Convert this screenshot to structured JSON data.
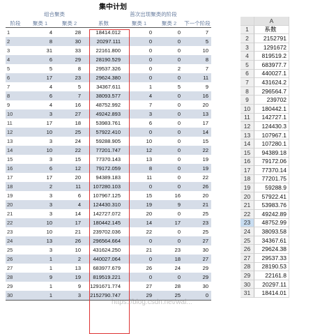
{
  "title": "集中计划",
  "left_table": {
    "group_headers": [
      "组合聚类",
      "首次出现聚类的阶段"
    ],
    "columns": [
      "阶段",
      "聚类 1",
      "聚类 2",
      "系数",
      "聚类 1",
      "聚类 2",
      "下一个阶段"
    ],
    "rows": [
      [
        "1",
        "4",
        "28",
        "18414.012",
        "0",
        "0",
        "7"
      ],
      [
        "2",
        "8",
        "30",
        "20297.111",
        "0",
        "0",
        "5"
      ],
      [
        "3",
        "31",
        "33",
        "22161.800",
        "0",
        "0",
        "10"
      ],
      [
        "4",
        "6",
        "29",
        "28190.529",
        "0",
        "0",
        "8"
      ],
      [
        "5",
        "5",
        "8",
        "29537.326",
        "0",
        "2",
        "7"
      ],
      [
        "6",
        "17",
        "23",
        "29624.380",
        "0",
        "0",
        "11"
      ],
      [
        "7",
        "4",
        "5",
        "34367.611",
        "1",
        "5",
        "9"
      ],
      [
        "8",
        "6",
        "7",
        "38093.577",
        "4",
        "0",
        "16"
      ],
      [
        "9",
        "4",
        "16",
        "48752.992",
        "7",
        "0",
        "20"
      ],
      [
        "10",
        "3",
        "27",
        "49242.893",
        "3",
        "0",
        "13"
      ],
      [
        "11",
        "17",
        "18",
        "53983.761",
        "6",
        "0",
        "17"
      ],
      [
        "12",
        "10",
        "25",
        "57922.410",
        "0",
        "0",
        "14"
      ],
      [
        "13",
        "3",
        "24",
        "59288.905",
        "10",
        "0",
        "15"
      ],
      [
        "14",
        "10",
        "22",
        "77201.747",
        "12",
        "0",
        "22"
      ],
      [
        "15",
        "3",
        "15",
        "77370.143",
        "13",
        "0",
        "19"
      ],
      [
        "16",
        "6",
        "12",
        "79172.059",
        "8",
        "0",
        "19"
      ],
      [
        "17",
        "17",
        "20",
        "94389.183",
        "11",
        "0",
        "22"
      ],
      [
        "18",
        "2",
        "11",
        "107280.103",
        "0",
        "0",
        "26"
      ],
      [
        "19",
        "3",
        "6",
        "107967.125",
        "15",
        "16",
        "20"
      ],
      [
        "20",
        "3",
        "4",
        "124430.310",
        "19",
        "9",
        "21"
      ],
      [
        "21",
        "3",
        "14",
        "142727.072",
        "20",
        "0",
        "25"
      ],
      [
        "22",
        "10",
        "17",
        "180442.145",
        "14",
        "17",
        "23"
      ],
      [
        "23",
        "10",
        "21",
        "239702.036",
        "22",
        "0",
        "25"
      ],
      [
        "24",
        "13",
        "26",
        "296564.664",
        "0",
        "0",
        "27"
      ],
      [
        "25",
        "3",
        "10",
        "431624.250",
        "21",
        "23",
        "30"
      ],
      [
        "26",
        "1",
        "2",
        "440027.064",
        "0",
        "18",
        "27"
      ],
      [
        "27",
        "1",
        "13",
        "683977.679",
        "26",
        "24",
        "29"
      ],
      [
        "28",
        "9",
        "19",
        "819519.221",
        "0",
        "0",
        "29"
      ],
      [
        "29",
        "1",
        "9",
        "1291671.774",
        "27",
        "28",
        "30"
      ],
      [
        "30",
        "1",
        "3",
        "2152790.747",
        "29",
        "25",
        "0"
      ]
    ]
  },
  "sheet": {
    "column_letter": "A",
    "header": "系数",
    "row_numbers": [
      "1",
      "2",
      "3",
      "4",
      "5",
      "6",
      "7",
      "8",
      "9",
      "10",
      "11",
      "12",
      "13",
      "14",
      "15",
      "16",
      "17",
      "18",
      "19",
      "20",
      "21",
      "22",
      "23",
      "24",
      "25",
      "26",
      "27",
      "28",
      "29",
      "30",
      "31"
    ],
    "values": [
      "2152791",
      "1291672",
      "819519.2",
      "683977.7",
      "440027.1",
      "431624.2",
      "296564.7",
      "239702",
      "180442.1",
      "142727.1",
      "124430.3",
      "107967.1",
      "107280.1",
      "94389.18",
      "79172.06",
      "77370.14",
      "77201.75",
      "59288.9",
      "57922.41",
      "53983.76",
      "49242.89",
      "48752.99",
      "38093.58",
      "34367.61",
      "29624.38",
      "29537.33",
      "28190.53",
      "22161.8",
      "20297.11",
      "18414.01"
    ],
    "selected_row": "23"
  },
  "watermark": "https://blog.csdn.net/wal..."
}
